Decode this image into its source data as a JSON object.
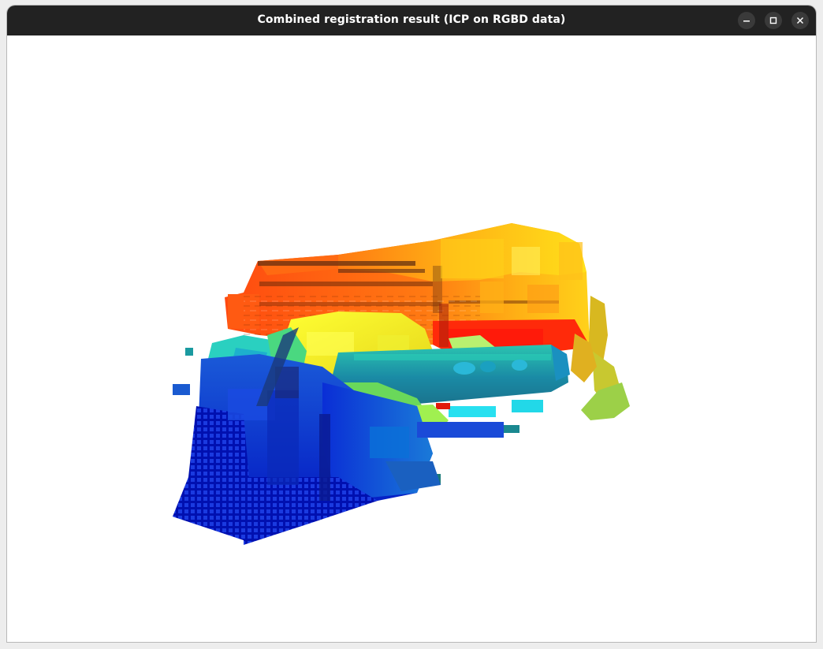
{
  "window": {
    "title": "Combined registration result (ICP on RGBD data)",
    "controls": {
      "minimize_icon": "minimize-icon",
      "maximize_icon": "maximize-icon",
      "close_icon": "close-icon"
    }
  },
  "viewport": {
    "background": "#ffffff",
    "content": "point-cloud",
    "colormap": [
      "#0000cc",
      "#0a47e0",
      "#12a0b8",
      "#22d8e8",
      "#8ee05a",
      "#ffff1a",
      "#ffa61a",
      "#ff5a10",
      "#ee1a0a"
    ]
  },
  "colors": {
    "titlebar": "#222222",
    "title_text": "#ffffff"
  }
}
